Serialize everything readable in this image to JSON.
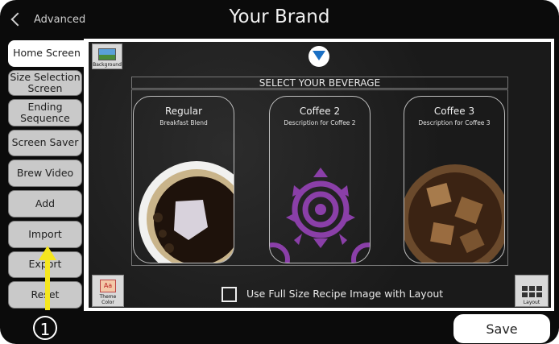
{
  "header": {
    "back_label": "Advanced",
    "title": "Your Brand"
  },
  "sidebar": {
    "items": [
      {
        "label": "Home Screen",
        "active": true
      },
      {
        "label": "Size Selection Screen"
      },
      {
        "label": "Ending Sequence"
      },
      {
        "label": "Screen Saver"
      },
      {
        "label": "Brew Video"
      },
      {
        "label": "Add"
      },
      {
        "label": "Import"
      },
      {
        "label": "Export"
      },
      {
        "label": "Reset"
      }
    ]
  },
  "screen": {
    "background_label": "Background",
    "theme_label": "Theme Color",
    "theme_icon_text": "Aa",
    "layout_label": "Layout",
    "heading": "SELECT YOUR BEVERAGE",
    "beverages": [
      {
        "name": "Regular",
        "description": "Breakfast Blend"
      },
      {
        "name": "Coffee 2",
        "description": "Description for Coffee 2"
      },
      {
        "name": "Coffee 3",
        "description": "Description for Coffee 3"
      }
    ],
    "checkbox_label": "Use Full Size Recipe Image with Layout",
    "checkbox_checked": false
  },
  "footer": {
    "step_number": "1",
    "save_label": "Save"
  },
  "colors": {
    "accent_arrow": "#f5e61e",
    "logo_blue": "#1a6fc4",
    "pattern_purple": "#8a3fa8"
  }
}
